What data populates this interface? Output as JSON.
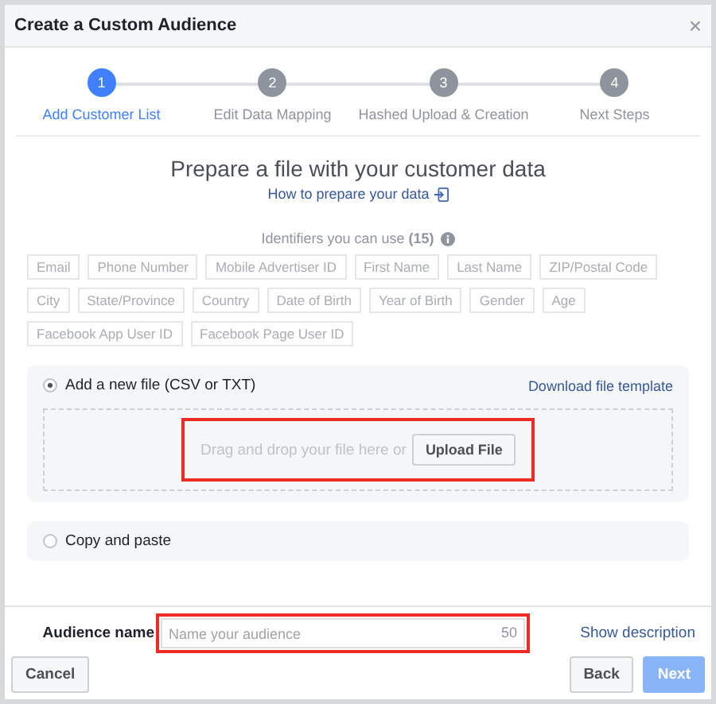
{
  "window": {
    "title": "Create a Custom Audience",
    "close": "×"
  },
  "steps": [
    {
      "number": "1",
      "label": "Add Customer List",
      "selected": true
    },
    {
      "number": "2",
      "label": "Edit Data Mapping",
      "selected": false
    },
    {
      "number": "3",
      "label": "Hashed Upload & Creation",
      "selected": false
    },
    {
      "number": "4",
      "label": "Next Steps",
      "selected": false
    }
  ],
  "heading": "Prepare a file with your customer data",
  "help_link": "How to prepare your data",
  "identifiers": {
    "label": "Identifiers you can use **(15)**",
    "tags": [
      "Email",
      "Phone Number",
      "Mobile Advertiser ID",
      "First Name",
      "Last Name",
      "ZIP/Postal Code",
      "City",
      "State/Province",
      "Country",
      "Date of Birth",
      "Year of Birth",
      "Gender",
      "Age",
      "Facebook App User ID",
      "Facebook Page User ID"
    ]
  },
  "options": [
    {
      "kind": "upload",
      "label": "Add a new file (CSV or TXT)",
      "selected": true,
      "link": "Download file template",
      "drop_text": "Drag and drop your file here or",
      "button": "Upload File",
      "highlighted": true
    },
    {
      "kind": "paste",
      "label": "Copy and paste",
      "selected": false
    }
  ],
  "audience_name": {
    "label": "Audience name",
    "placeholder": "Name your audience",
    "counter": "50",
    "highlighted": true,
    "link": "Show description"
  },
  "buttons": [
    {
      "label": "Cancel",
      "disabled": false
    },
    {
      "label": "Back",
      "disabled": false
    },
    {
      "label": "Next",
      "disabled": true
    }
  ]
}
